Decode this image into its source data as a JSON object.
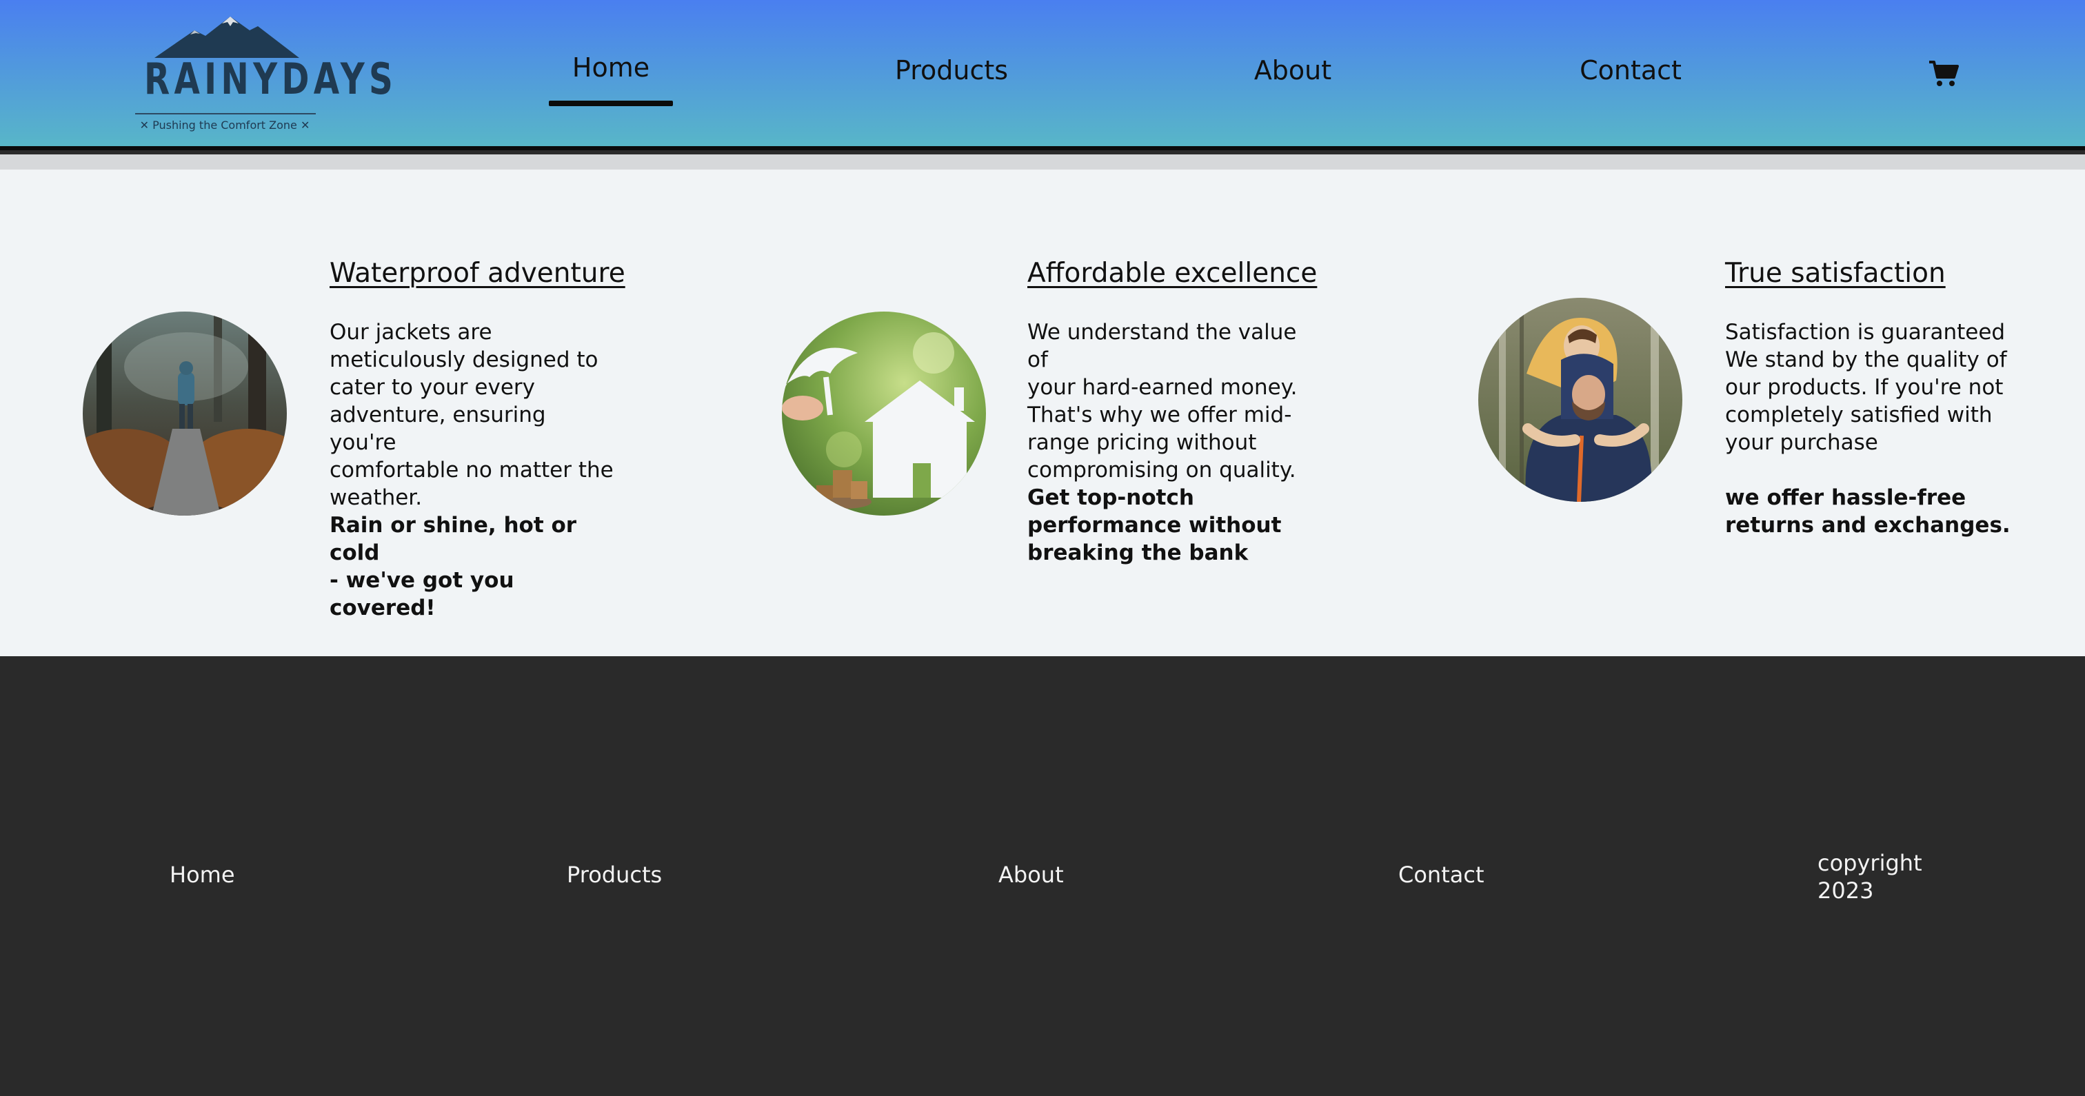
{
  "header": {
    "logo": {
      "word": "RAINYDAYS",
      "tagline": "✕ Pushing the Comfort Zone ✕",
      "icon": "mountain-logo"
    },
    "nav": [
      {
        "label": "Home",
        "active": true
      },
      {
        "label": "Products"
      },
      {
        "label": "About"
      },
      {
        "label": "Contact"
      }
    ],
    "cart_icon": "shopping-cart-icon",
    "colors": {
      "gradient_top": "#4a7ff0",
      "gradient_bottom": "#58b6c8"
    }
  },
  "features": [
    {
      "title": "Waterproof adventure",
      "body": "Our jackets are\nmeticulously designed to\ncater to your every\nadventure, ensuring you're\ncomfortable no matter the\nweather.",
      "highlight": "Rain or shine, hot or cold\n- we've got you covered!",
      "image": "hiker-in-forest"
    },
    {
      "title": "Affordable excellence",
      "body": "We understand the value of\nyour hard-earned money.\nThat's why we offer mid-\nrange pricing without\ncompromising on quality.",
      "highlight": "Get top-notch\nperformance without\nbreaking the bank",
      "image": "house-umbrella-coins"
    },
    {
      "title": "True satisfaction",
      "body": "Satisfaction is guaranteed\nWe stand by the quality of\nour products. If you're not\ncompletely satisfied with\nyour purchase",
      "highlight": "we offer hassle-free\nreturns and exchanges.",
      "image": "happy-couple-piggyback"
    }
  ],
  "footer": {
    "links": [
      {
        "label": "Home"
      },
      {
        "label": "Products"
      },
      {
        "label": "About"
      },
      {
        "label": "Contact"
      }
    ],
    "copyright": "copyright\n2023",
    "background": "#2a2a2a"
  }
}
